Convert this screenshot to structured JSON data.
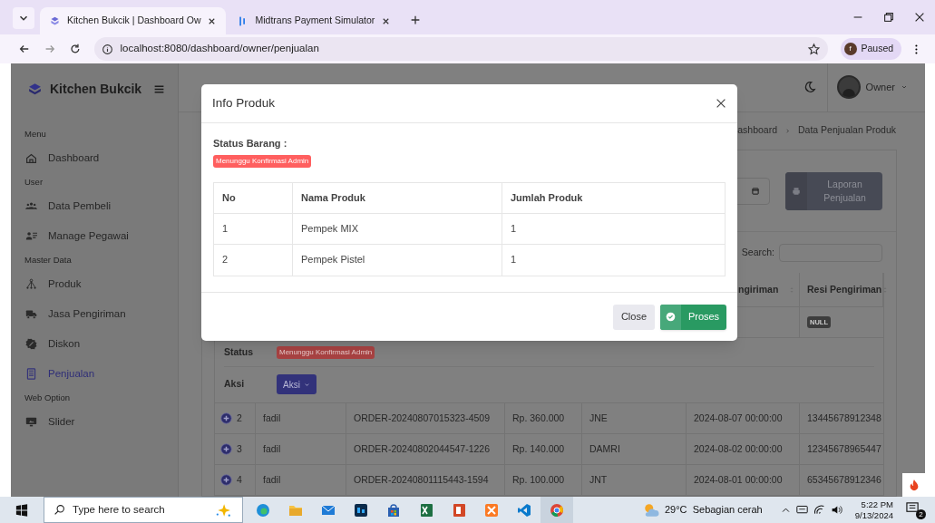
{
  "browser": {
    "tabs": [
      {
        "title": "Kitchen Bukcik | Dashboard Ow",
        "selected": true
      },
      {
        "title": "Midtrans Payment Simulator",
        "selected": false
      }
    ],
    "url": "localhost:8080/dashboard/owner/penjualan",
    "profile_initial": "f",
    "profile_status": "Paused"
  },
  "sidebar": {
    "brand": "Kitchen Bukcik",
    "sections": [
      {
        "heading": "Menu",
        "items": [
          {
            "label": "Dashboard",
            "selected": false
          }
        ]
      },
      {
        "heading": "User",
        "items": [
          {
            "label": "Data Pembeli",
            "selected": false
          },
          {
            "label": "Manage Pegawai",
            "selected": false
          }
        ]
      },
      {
        "heading": "Master Data",
        "items": [
          {
            "label": "Produk",
            "selected": false
          },
          {
            "label": "Jasa Pengiriman",
            "selected": false
          },
          {
            "label": "Diskon",
            "selected": false
          },
          {
            "label": "Penjualan",
            "selected": true
          }
        ]
      },
      {
        "heading": "Web Option",
        "items": [
          {
            "label": "Slider",
            "selected": false
          }
        ]
      }
    ]
  },
  "header": {
    "user": "Owner"
  },
  "breadcrumb": [
    "ashboard",
    "Data Penjualan Produk"
  ],
  "report_button": "Laporan Penjualan",
  "search_label": "Search:",
  "table": {
    "columns": [
      "",
      "",
      "",
      "",
      "",
      "ngiriman",
      "Resi Pengiriman"
    ],
    "first_row": {
      "resi": "NULL"
    },
    "detail": {
      "status_label": "Status",
      "status": "Menunggu Konfirmasi Admin",
      "action_label": "Aksi",
      "action_button": "Aksi"
    },
    "rows": [
      {
        "cells": [
          "2",
          "fadil",
          "ORDER-20240807015323-4509",
          "Rp. 360.000",
          "JNE",
          "2024-08-07 00:00:00",
          "13445678912348"
        ]
      },
      {
        "cells": [
          "3",
          "fadil",
          "ORDER-20240802044547-1226",
          "Rp. 140.000",
          "DAMRI",
          "2024-08-02 00:00:00",
          "12345678965447"
        ]
      },
      {
        "cells": [
          "4",
          "fadil",
          "ORDER-20240801115443-1594",
          "Rp. 100.000",
          "JNT",
          "2024-08-01 00:00:00",
          "65345678912346"
        ]
      }
    ]
  },
  "modal": {
    "title": "Info Produk",
    "status_label": "Status Barang :",
    "status": "Menunggu Konfirmasi Admin",
    "columns": [
      "No",
      "Nama Produk",
      "Jumlah Produk"
    ],
    "rows": [
      [
        "1",
        "Pempek MIX",
        "1"
      ],
      [
        "2",
        "Pempek Pistel",
        "1"
      ]
    ],
    "close_button": "Close",
    "process_button": "Proses"
  },
  "taskbar": {
    "search_placeholder": "Type here to search",
    "weather": "29°C  Sebagian cerah",
    "time": "5:22 PM",
    "date": "9/13/2024",
    "notifications": "2"
  }
}
